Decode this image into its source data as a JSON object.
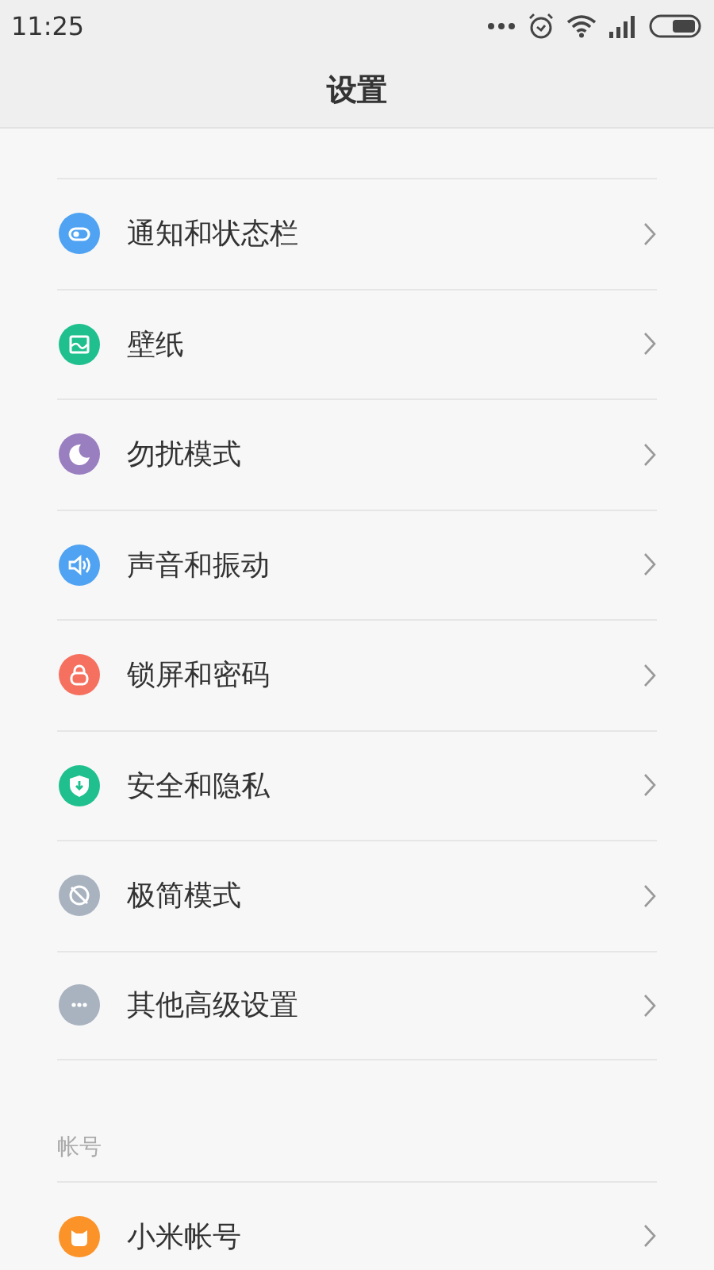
{
  "status_bar": {
    "time": "11:25"
  },
  "title": "设置",
  "sections": [
    {
      "items": [
        {
          "label": "通知和状态栏",
          "kind": "toggle",
          "color": "#4fa3f2"
        },
        {
          "label": "壁纸",
          "kind": "image",
          "color": "#1fc08e"
        },
        {
          "label": "勿扰模式",
          "kind": "moon",
          "color": "#9a7fc0"
        },
        {
          "label": "声音和振动",
          "kind": "speaker",
          "color": "#4fa3f2"
        },
        {
          "label": "锁屏和密码",
          "kind": "lock",
          "color": "#f6705f"
        },
        {
          "label": "安全和隐私",
          "kind": "shield",
          "color": "#1fc08e"
        },
        {
          "label": "极简模式",
          "kind": "slash",
          "color": "#a8b3bf"
        },
        {
          "label": "其他高级设置",
          "kind": "dots",
          "color": "#a8b3bf"
        }
      ]
    },
    {
      "header": "帐号",
      "items": [
        {
          "label": "小米帐号",
          "kind": "cat",
          "color": "#fb9328"
        }
      ]
    }
  ]
}
